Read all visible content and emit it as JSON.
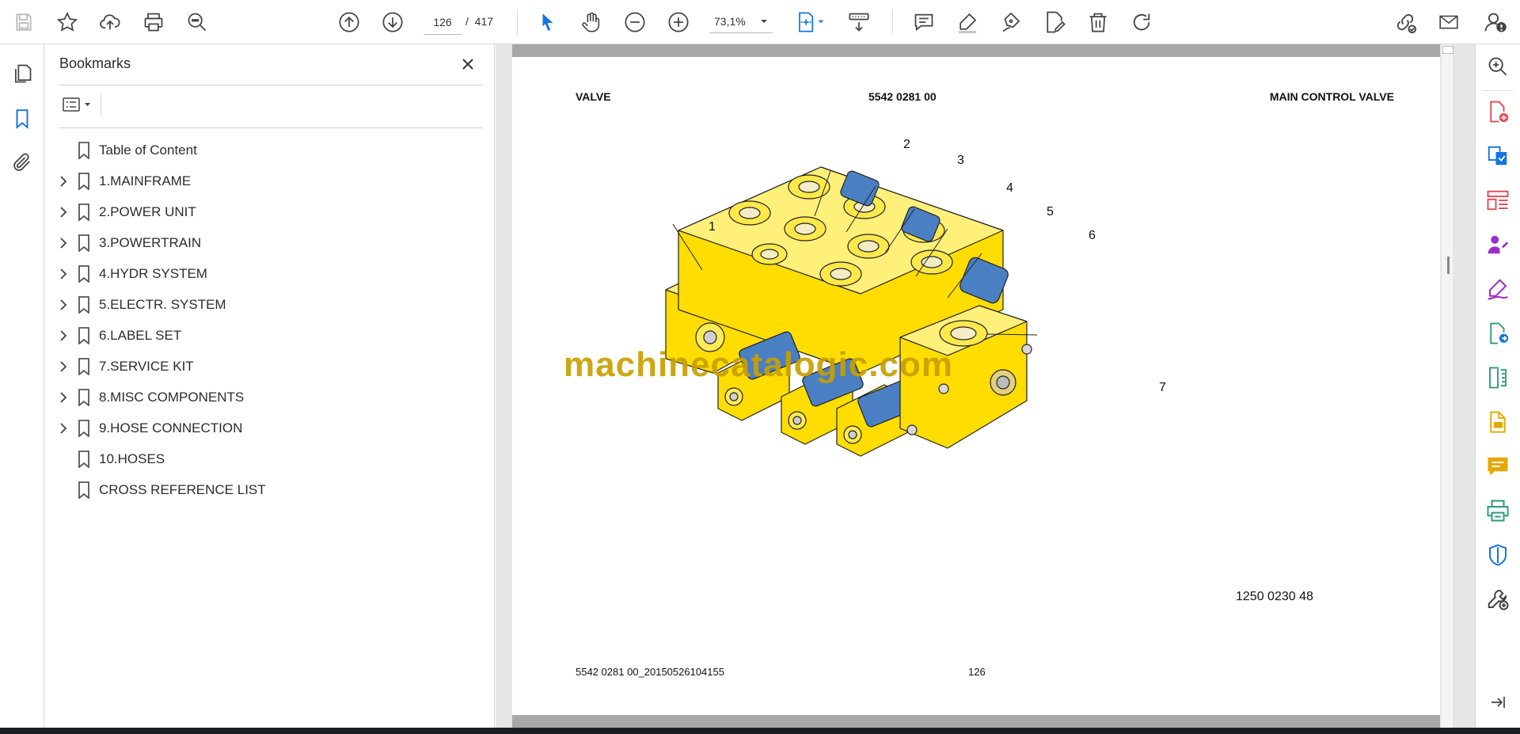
{
  "toolbar": {
    "icons": [
      "save-icon",
      "bookmark-star-icon",
      "upload-icon",
      "print-icon",
      "search-zoom-icon",
      "previous-page-icon",
      "next-page-icon",
      "select-cursor-icon",
      "hand-tool-icon",
      "zoom-out-icon",
      "zoom-in-icon",
      "fit-page-icon",
      "scroll-mode-icon",
      "comment-icon",
      "highlight-icon",
      "sign-icon",
      "edit-pdf-icon",
      "delete-icon",
      "rotate-icon",
      "share-link-icon",
      "email-icon",
      "account-icon"
    ],
    "current_page": "126",
    "page_separator": "/",
    "total_pages": "417",
    "zoom": "73,1%"
  },
  "bookmarks": {
    "title": "Bookmarks",
    "items": [
      {
        "label": "Table of Content",
        "expandable": false
      },
      {
        "label": "1.MAINFRAME",
        "expandable": true
      },
      {
        "label": "2.POWER UNIT",
        "expandable": true
      },
      {
        "label": "3.POWERTRAIN",
        "expandable": true
      },
      {
        "label": "4.HYDR SYSTEM",
        "expandable": true
      },
      {
        "label": "5.ELECTR. SYSTEM",
        "expandable": true
      },
      {
        "label": "6.LABEL SET",
        "expandable": true
      },
      {
        "label": "7.SERVICE KIT",
        "expandable": true
      },
      {
        "label": "8.MISC COMPONENTS",
        "expandable": true
      },
      {
        "label": "9.HOSE CONNECTION",
        "expandable": true
      },
      {
        "label": "10.HOSES",
        "expandable": false
      },
      {
        "label": "CROSS REFERENCE LIST",
        "expandable": false
      }
    ]
  },
  "document": {
    "header_left": "VALVE",
    "header_center": "5542 0281 00",
    "header_right": "MAIN CONTROL VALVE",
    "callouts": [
      "1",
      "2",
      "3",
      "4",
      "5",
      "6",
      "7"
    ],
    "drawing_number": "1250 0230 48",
    "footer_left": "5542 0281 00_20150526104155",
    "footer_page": "126",
    "watermark": "machinecatalogic.com"
  },
  "colors": {
    "valve_yellow": "#ffdd00",
    "spool_blue": "#4a7fc4",
    "watermark_gold": "#c8a000",
    "accent_blue": "#1473e6",
    "tool_red": "#e34850",
    "tool_green": "#2d9d78"
  }
}
